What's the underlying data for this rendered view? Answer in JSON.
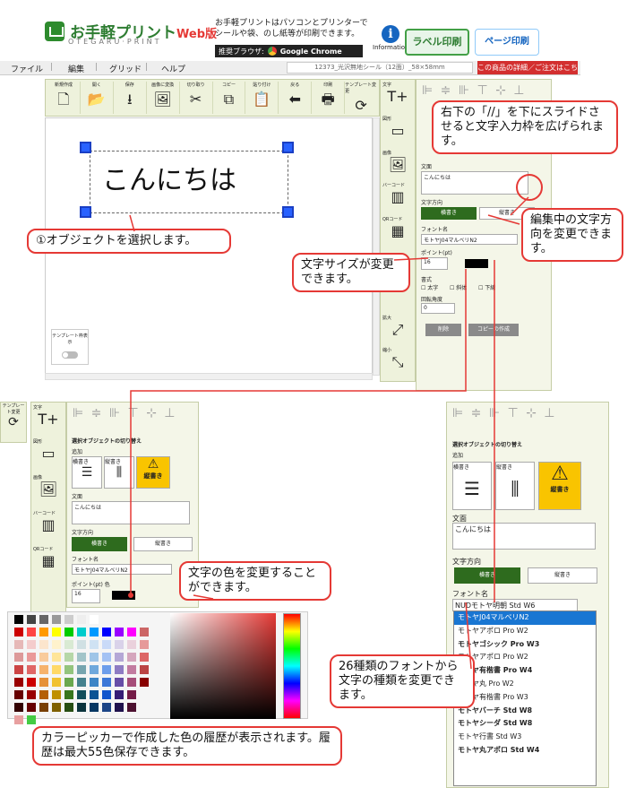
{
  "header": {
    "logo_title": "お手軽プリント",
    "logo_badge": "Web版",
    "logo_sub": "OTEGARU·PRINT",
    "intro_text": "お手軽プリントはパソコンとプリンターでシールや袋、のし紙等が印刷できます。",
    "recommended_label": "推奨ブラウザ:",
    "browser": "Google Chrome",
    "info_label": "Information",
    "label_button": "ラベル印刷",
    "page_button": "ページ印刷"
  },
  "menu": {
    "items": [
      "ファイル",
      "編集",
      "グリッド",
      "ヘルプ"
    ],
    "document_title": "12373_光沢無地シール（12面）_58×58mm",
    "detail_button": "この商品の詳細／ご注文はこちら"
  },
  "toolbar": {
    "buttons": [
      {
        "label": "新規作成",
        "icon": "new-file-icon"
      },
      {
        "label": "開く",
        "icon": "open-folder-icon"
      },
      {
        "label": "保存",
        "icon": "download-icon"
      },
      {
        "label": "画像に変換",
        "icon": "image-icon"
      },
      {
        "label": "切り取り",
        "icon": "scissors-icon"
      },
      {
        "label": "コピー",
        "icon": "copy-icon"
      },
      {
        "label": "貼り付け",
        "icon": "paste-icon"
      },
      {
        "label": "戻る",
        "icon": "back-arrow-icon"
      },
      {
        "label": "印刷",
        "icon": "printer-icon"
      },
      {
        "label": "テンプレート変更",
        "icon": "refresh-icon"
      }
    ]
  },
  "canvas": {
    "text": "こんにちは",
    "template_toggle_label": "テンプレート枠表示"
  },
  "sidebar": {
    "items": [
      "文字",
      "図形",
      "画像",
      "バーコード",
      "QRコード",
      "拡大",
      "縮小"
    ]
  },
  "sidebar2": {
    "items": [
      "文字",
      "図形",
      "画像",
      "バーコード",
      "QRコード"
    ],
    "template_label": "テンプレート変更"
  },
  "props": {
    "align_labels": [
      "左揃え",
      "左右中央",
      "右揃え",
      "上揃え",
      "上下中央",
      "下揃え"
    ],
    "select_switch": "選択オブジェクトの切り替え",
    "add_label": "追加",
    "horizontal": "横書き",
    "vertical": "縦書き",
    "warning": "縦書き",
    "text_label": "文面",
    "text_value": "こんにちは",
    "direction_label": "文字方向",
    "font_label": "フォント名",
    "font_value": "モトヤJ04マルベリN2",
    "font_value_3": "NUDモトヤ明朝 Std W6",
    "size_label": "ポイント(pt)",
    "color_label": "色",
    "size_value": "16",
    "style_label": "書式",
    "bold": "太字",
    "italic": "斜体",
    "underline": "下線",
    "rotation_label": "回転角度",
    "rotation_value": "0",
    "delete_button": "削除",
    "copy_button": "コピーの作成"
  },
  "fonts": [
    "モトヤJ04マルベリN2",
    "モトヤアポロ Pro W2",
    "モトヤゴシック Pro W3",
    "モトヤアポロ Pro W2",
    "モトヤ有楷書 Pro W4",
    "モトヤ丸 Pro W2",
    "モトヤ有楷書 Pro W3",
    "モトヤバーチ Std W8",
    "モトヤシーダ Std W8",
    "モトヤ行書 Std W3",
    "モトヤ丸アポロ Std W4"
  ],
  "callouts": {
    "select_object": "①オブジェクトを選択します。",
    "slide_resize": "右下の「//」を下にスライドさせると文字入力枠を広げられます。",
    "direction_change": "編集中の文字方向を変更できます。",
    "size_change": "文字サイズが変更できます。",
    "color_change": "文字の色を変更することができます。",
    "font_change": "26種類のフォントから文字の種類を変更できます。",
    "picker_history": "カラーピッカーで作成した色の履歴が表示されます。履歴は最大55色保存できます。"
  },
  "colors": {
    "accent_green": "#2e6b1e",
    "red": "#e53935",
    "panel": "#eef2dc"
  }
}
